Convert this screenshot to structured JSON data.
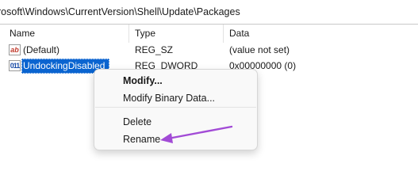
{
  "address": {
    "path": "rosoft\\Windows\\CurrentVersion\\Shell\\Update\\Packages"
  },
  "columns": {
    "name": "Name",
    "type": "Type",
    "data": "Data"
  },
  "rows": [
    {
      "icon": "string-value-icon",
      "icon_glyph": "ab",
      "name": "(Default)",
      "type": "REG_SZ",
      "data": "(value not set)"
    },
    {
      "icon": "dword-value-icon",
      "icon_glyph": "011",
      "name": "UndockingDisabled",
      "type": "REG_DWORD",
      "data": "0x00000000 (0)"
    }
  ],
  "context_menu": {
    "items": [
      {
        "label": "Modify...",
        "bold": true
      },
      {
        "label": "Modify Binary Data..."
      },
      {
        "label": "Delete"
      },
      {
        "label": "Rename"
      }
    ]
  },
  "colors": {
    "selection": "#0a64d0",
    "annotation_arrow": "#a24bd6"
  }
}
